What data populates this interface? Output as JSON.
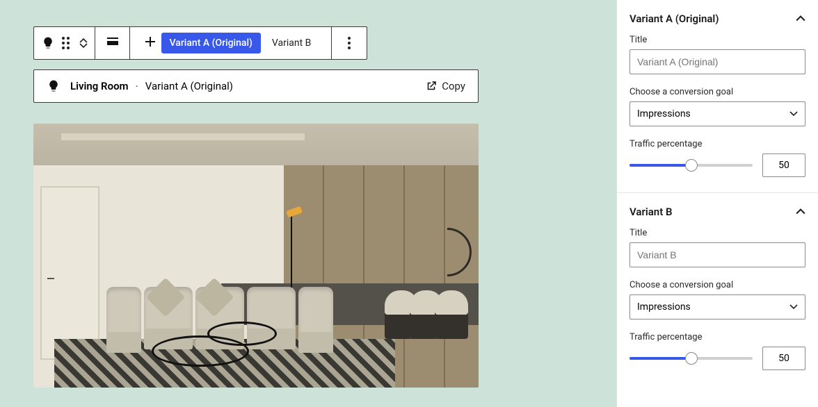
{
  "toolbar": {
    "variant_a_label": "Variant A (Original)",
    "variant_b_label": "Variant B"
  },
  "breadcrumb": {
    "room": "Living Room",
    "variant": "Variant A (Original)",
    "copy_label": "Copy"
  },
  "sidebar": {
    "a": {
      "header": "Variant A (Original)",
      "title_label": "Title",
      "title_placeholder": "Variant A (Original)",
      "goal_label": "Choose a conversion goal",
      "goal_value": "Impressions",
      "traffic_label": "Traffic percentage",
      "traffic_value": "50",
      "traffic_pct": 50
    },
    "b": {
      "header": "Variant B",
      "title_label": "Title",
      "title_placeholder": "Variant B",
      "goal_label": "Choose a conversion goal",
      "goal_value": "Impressions",
      "traffic_label": "Traffic percentage",
      "traffic_value": "50",
      "traffic_pct": 50
    }
  }
}
